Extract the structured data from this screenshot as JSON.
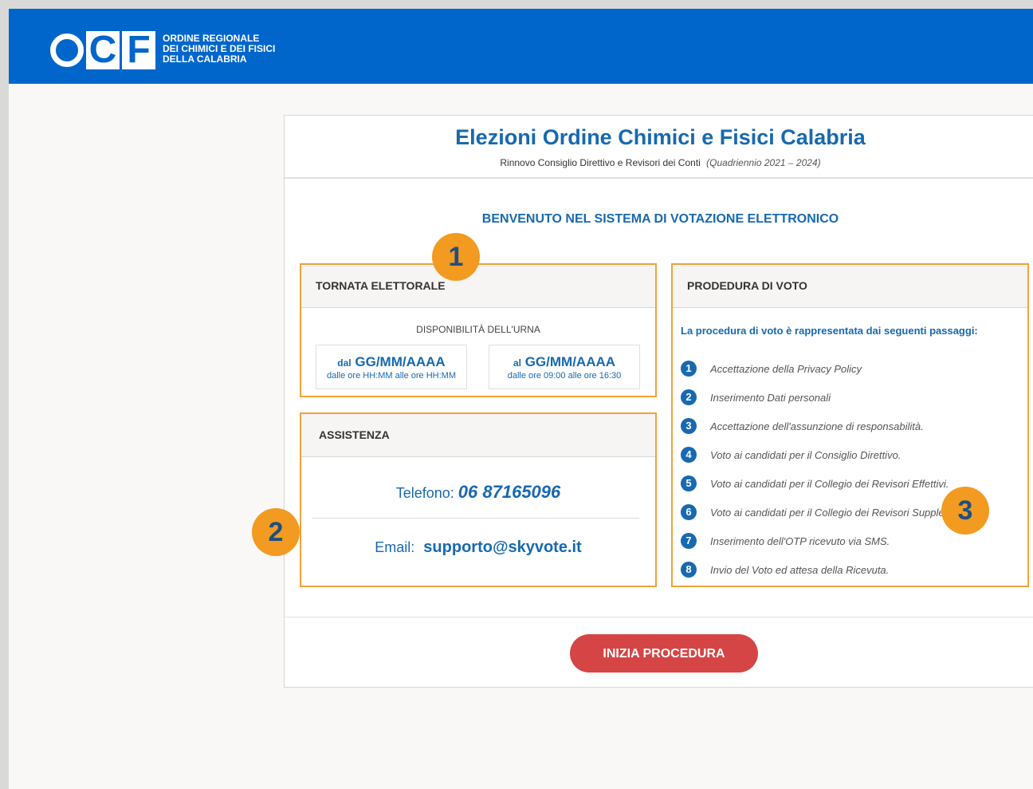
{
  "header": {
    "logo_text": "OCF",
    "org_lines": [
      "ORDINE REGIONALE",
      "DEI CHIMICI E DEI FISICI",
      "DELLA CALABRIA"
    ]
  },
  "card": {
    "title": "Elezioni Ordine Chimici e Fisici Calabria",
    "subtitle": "Rinnovo Consiglio Direttivo e Revisori dei Conti",
    "subtitle_period": "(Quadriennio 2021 – 2024)",
    "welcome": "BENVENUTO NEL SISTEMA DI VOTAZIONE ELETTRONICO"
  },
  "tornata": {
    "heading": "TORNATA ELETTORALE",
    "availability": "DISPONIBILITÀ DELL'URNA",
    "from_prefix": "dal",
    "from_date": "GG/MM/AAAA",
    "from_hours": "dalle ore HH:MM alle ore HH:MM",
    "to_prefix": "al",
    "to_date": "GG/MM/AAAA",
    "to_hours": "dalle ore 09:00 alle ore 16:30"
  },
  "assistenza": {
    "heading": "ASSISTENZA",
    "phone_label": "Telefono:",
    "phone": "06 87165096",
    "email_label": "Email:",
    "email": "supporto@skyvote.it"
  },
  "procedura": {
    "heading": "PRODEDURA DI VOTO",
    "intro": "La procedura di voto è rappresentata dai seguenti passaggi:",
    "steps": [
      {
        "n": "1",
        "text": "Accettazione della Privacy Policy"
      },
      {
        "n": "2",
        "text": "Inserimento Dati personali"
      },
      {
        "n": "3",
        "text": "Accettazione dell'assunzione di responsabilità."
      },
      {
        "n": "4",
        "text": "Voto ai candidati per il Consiglio Direttivo."
      },
      {
        "n": "5",
        "text": "Voto ai candidati per il Collegio dei Revisori Effettivi."
      },
      {
        "n": "6",
        "text": "Voto ai candidati per il Collegio dei Revisori Supplenti."
      },
      {
        "n": "7",
        "text": "Inserimento dell'OTP ricevuto via SMS."
      },
      {
        "n": "8",
        "text": "Invio del Voto ed attesa della Ricevuta."
      }
    ]
  },
  "badges": {
    "one": "1",
    "two": "2",
    "three": "3"
  },
  "footer": {
    "start_button": "INIZIA PROCEDURA"
  },
  "colors": {
    "header_blue": "#0066cc",
    "accent_blue": "#1769b0",
    "highlight_orange": "#f39a21",
    "button_red": "#d64545"
  }
}
